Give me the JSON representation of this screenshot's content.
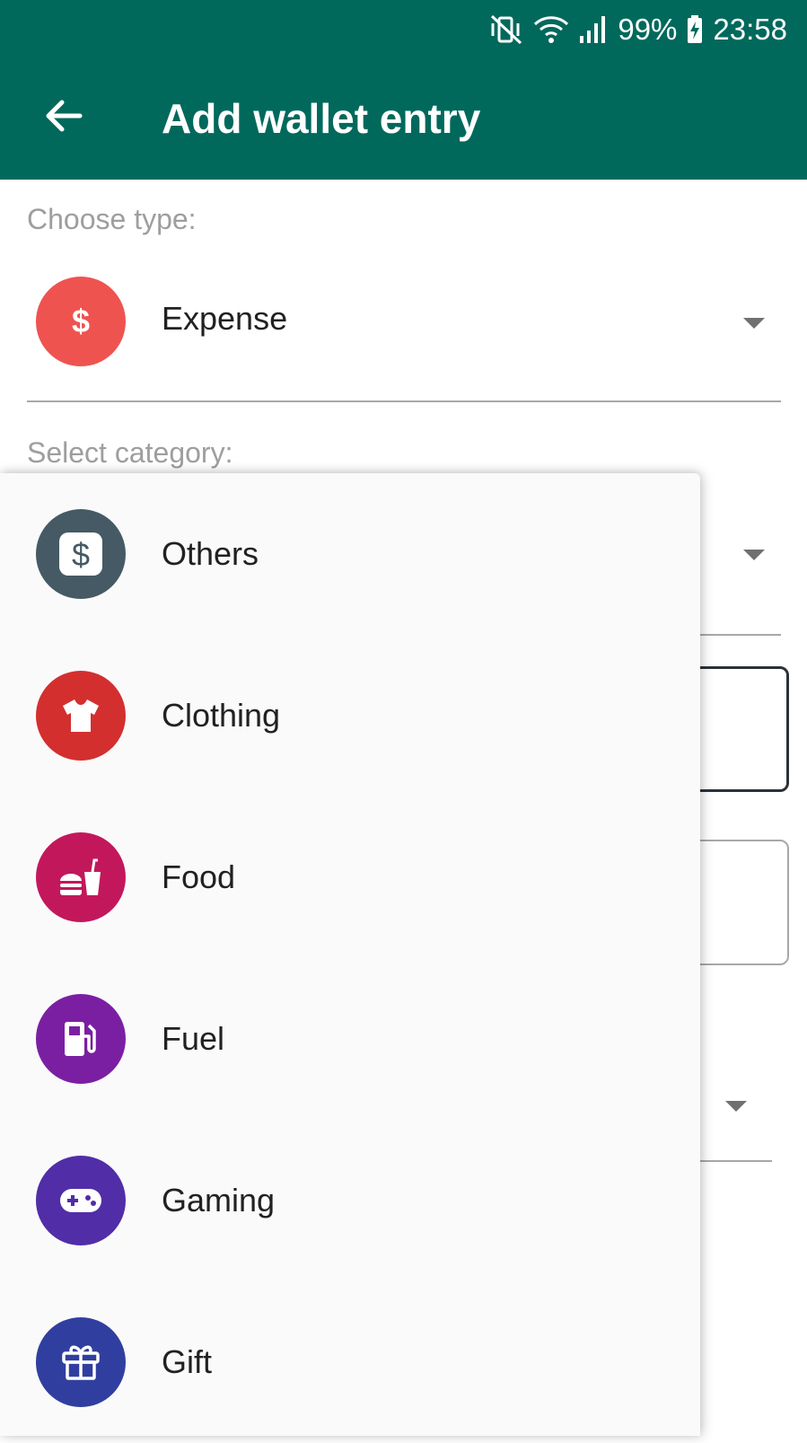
{
  "status_bar": {
    "battery": "99%",
    "time": "23:58",
    "icons": [
      "vibrate-mute-icon",
      "wifi-icon",
      "signal-icon",
      "battery-charging-icon"
    ]
  },
  "app_bar": {
    "title": "Add wallet entry",
    "back_icon": "arrow-left-icon",
    "color": "#00695c"
  },
  "type_section": {
    "label": "Choose type:",
    "selected": {
      "label": "Expense",
      "icon": "dollar-icon",
      "color": "#ef5350"
    }
  },
  "category_section": {
    "label": "Select category:",
    "options": [
      {
        "label": "Others",
        "icon": "dollar-box-icon",
        "color": "#455a64"
      },
      {
        "label": "Clothing",
        "icon": "tshirt-icon",
        "color": "#d32f2f"
      },
      {
        "label": "Food",
        "icon": "fast-food-icon",
        "color": "#c2185b"
      },
      {
        "label": "Fuel",
        "icon": "gas-pump-icon",
        "color": "#7b1fa2"
      },
      {
        "label": "Gaming",
        "icon": "gamepad-icon",
        "color": "#512da8"
      },
      {
        "label": "Gift",
        "icon": "gift-icon",
        "color": "#303f9f"
      }
    ]
  }
}
